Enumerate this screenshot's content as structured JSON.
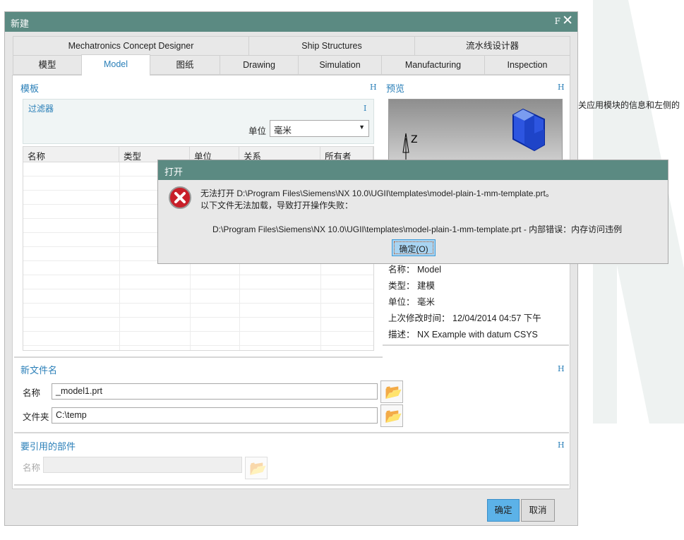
{
  "background": {
    "side_text": "关应用模块的信息和左侧的"
  },
  "dialog": {
    "title": "新建",
    "title_icon": "F",
    "close_icon": "close-icon",
    "tabs_row1": [
      "Mechatronics Concept Designer",
      "Ship Structures",
      "流水线设计器"
    ],
    "tabs_row2": [
      "模型",
      "Model",
      "图纸",
      "Drawing",
      "Simulation",
      "Manufacturing",
      "Inspection"
    ],
    "selected_tab": "Model",
    "template": {
      "title": "模板",
      "collapse": "H",
      "filter": {
        "title": "过滤器",
        "collapse": "I",
        "unit_label": "单位",
        "unit_value": "毫米"
      },
      "columns": [
        "名称",
        "类型",
        "单位",
        "关系",
        "所有者"
      ]
    },
    "preview": {
      "title": "预览",
      "collapse": "H",
      "axis": "Z"
    },
    "properties": [
      {
        "label": "名称：",
        "value": "Model"
      },
      {
        "label": "类型：",
        "value": "建模"
      },
      {
        "label": "单位：",
        "value": "毫米"
      },
      {
        "label": "上次修改时间：",
        "value": "12/04/2014 04:57 下午"
      },
      {
        "label": "描述：",
        "value": "NX Example with datum CSYS"
      }
    ],
    "new_file": {
      "title": "新文件名",
      "collapse": "H",
      "name_label": "名称",
      "name_value": "_model1.prt",
      "folder_label": "文件夹",
      "folder_value": "C:\\temp"
    },
    "ref_part": {
      "title": "要引用的部件",
      "collapse": "H",
      "name_label": "名称",
      "name_value": ""
    },
    "ok": "确定",
    "cancel": "取消"
  },
  "error": {
    "title": "打开",
    "line1": "无法打开 D:\\Program Files\\Siemens\\NX 10.0\\UGII\\templates\\model-plain-1-mm-template.prt。",
    "line2": "以下文件无法加载，导致打开操作失败：",
    "detail": "D:\\Program Files\\Siemens\\NX 10.0\\UGII\\templates\\model-plain-1-mm-template.prt - 内部错误：内存访问违例",
    "ok": "确定(O)",
    "icon": "error-icon"
  },
  "colors": {
    "titlebar": "#5b8a82",
    "accent": "#2a7fb8",
    "error": "#c8202a"
  }
}
